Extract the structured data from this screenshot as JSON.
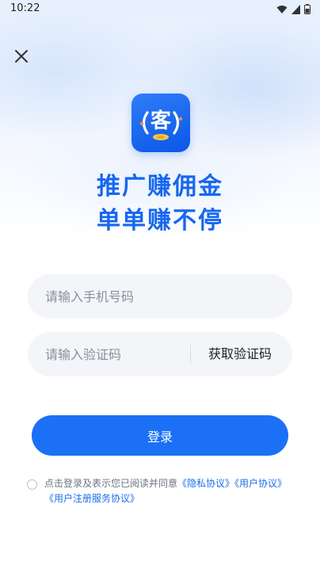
{
  "status_bar": {
    "time": "10:22"
  },
  "header": {
    "close_icon": "close-icon"
  },
  "logo": {
    "glyph": "客"
  },
  "slogan": {
    "line1": "推广赚佣金",
    "line2": "单单赚不停"
  },
  "form": {
    "phone_placeholder": "请输入手机号码",
    "code_placeholder": "请输入验证码",
    "get_code_label": "获取验证码",
    "login_label": "登录"
  },
  "agreement": {
    "prefix": "点击登录及表示您已阅读并同意",
    "privacy": "《隐私协议》",
    "user": "《用户协议》",
    "register_service": "《用户注册服务协议》"
  },
  "colors": {
    "accent": "#1c70f5",
    "slogan": "#1767f0",
    "link": "#1c6fe8",
    "field_bg": "#f3f5f9"
  }
}
